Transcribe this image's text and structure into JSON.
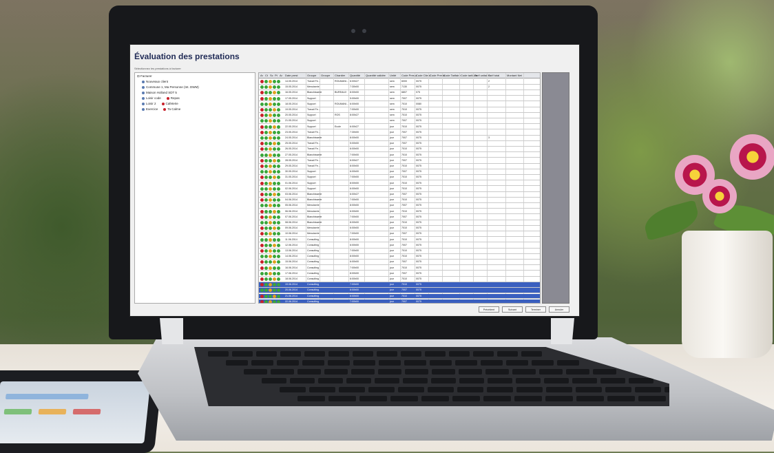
{
  "window": {
    "title": "Évaluation des prestations",
    "subtitle": "Sélectionnez les prestations à facturer"
  },
  "tree": {
    "root": "Facturer",
    "items": [
      {
        "label": "Nouveaux client",
        "badge": ""
      },
      {
        "label": "Commune 1, Ma Personne (Int. DWM)",
        "badge": ""
      },
      {
        "label": "Maison Holland SDT 5",
        "badge": ""
      },
      {
        "label": "Loisir code",
        "badge": "Repas"
      },
      {
        "label": "Loisir 2",
        "badge": "Cafeterie"
      },
      {
        "label": "Exercice",
        "badge": "Ta Calme"
      }
    ]
  },
  "grid": {
    "columns": [
      "Ar",
      "Ct",
      "Sc",
      "Pt",
      "Ar",
      "Date prest",
      "Groupe",
      "Groupe",
      "Chantier",
      "Quantité",
      "Quantité validée",
      "Unité",
      "Code Presta",
      "Code Client",
      "Code Presta",
      "Code Tarifaire",
      "Code tarifaire",
      "Tarif unitaire",
      "Tarif total",
      "Montant Net"
    ],
    "rows": [
      {
        "date": "14.05.2014",
        "group": "Travail Fe...",
        "chantier": "ROUMANI...",
        "qty": "6:00h27",
        "unit": "sem",
        "code1": "6000",
        "code2": "0075",
        "num": "2",
        "sel": false
      },
      {
        "date": "15.05.2014",
        "group": "Menuiserie",
        "chantier": "",
        "qty": "7:30h00",
        "unit": "sem",
        "code1": "7130",
        "code2": "0075",
        "num": "2",
        "sel": false
      },
      {
        "date": "16.05.2014",
        "group": "Blanchisserie",
        "chantier": "BUREAUX",
        "qty": "8:00h00",
        "unit": "sem",
        "code1": "6807",
        "code2": "075",
        "num": "",
        "sel": false
      },
      {
        "date": "17.05.2014",
        "group": "Support",
        "chantier": "",
        "qty": "5:00h00",
        "unit": "sem",
        "code1": "7007",
        "code2": "0075",
        "num": "",
        "sel": false
      },
      {
        "date": "18.05.2014",
        "group": "Support",
        "chantier": "ROUMANI...",
        "qty": "6:00h00",
        "unit": "sem",
        "code1": "7010",
        "code2": "0080",
        "num": "",
        "sel": false
      },
      {
        "date": "19.05.2014",
        "group": "Travail Fe...",
        "chantier": "",
        "qty": "7:00h00",
        "unit": "sem",
        "code1": "7010",
        "code2": "0075",
        "num": "",
        "sel": false
      },
      {
        "date": "20.05.2014",
        "group": "Support",
        "chantier": "ROS",
        "qty": "8:00h27",
        "unit": "sem",
        "code1": "7010",
        "code2": "0075",
        "num": "",
        "sel": false
      },
      {
        "date": "21.05.2014",
        "group": "Support",
        "chantier": "",
        "qty": "",
        "unit": "sem",
        "code1": "7007",
        "code2": "0075",
        "num": "",
        "sel": false
      },
      {
        "date": "22.05.2014",
        "group": "Support",
        "chantier": "Ecole",
        "qty": "6:00h27",
        "unit": "jour",
        "code1": "7010",
        "code2": "0075",
        "num": "",
        "sel": false
      },
      {
        "date": "23.05.2014",
        "group": "Travail Fe...",
        "chantier": "",
        "qty": "7:30h00",
        "unit": "jour",
        "code1": "7007",
        "code2": "0075",
        "num": "",
        "sel": false
      },
      {
        "date": "24.05.2014",
        "group": "Blanchisserie",
        "chantier": "",
        "qty": "8:00h00",
        "unit": "jour",
        "code1": "7007",
        "code2": "0075",
        "num": "3",
        "sel": false
      },
      {
        "date": "25.05.2014",
        "group": "Travail Fe...",
        "chantier": "",
        "qty": "5:00h00",
        "unit": "jour",
        "code1": "7007",
        "code2": "0075",
        "num": "",
        "sel": false
      },
      {
        "date": "26.05.2014",
        "group": "Travail Fe...",
        "chantier": "",
        "qty": "6:00h00",
        "unit": "jour",
        "code1": "7010",
        "code2": "0075",
        "num": "",
        "sel": false
      },
      {
        "date": "27.05.2014",
        "group": "Blanchisserie",
        "chantier": "",
        "qty": "7:00h00",
        "unit": "jour",
        "code1": "7010",
        "code2": "0075",
        "num": "",
        "sel": false
      },
      {
        "date": "28.05.2014",
        "group": "Travail Fe...",
        "chantier": "",
        "qty": "6:00h27",
        "unit": "jour",
        "code1": "7007",
        "code2": "0075",
        "num": "",
        "sel": false
      },
      {
        "date": "29.05.2014",
        "group": "Travail Fe...",
        "chantier": "",
        "qty": "8:00h00",
        "unit": "jour",
        "code1": "7010",
        "code2": "0075",
        "num": "",
        "sel": false
      },
      {
        "date": "30.05.2014",
        "group": "Support",
        "chantier": "",
        "qty": "6:00h00",
        "unit": "jour",
        "code1": "7007",
        "code2": "0075",
        "num": "",
        "sel": false
      },
      {
        "date": "31.05.2014",
        "group": "Support",
        "chantier": "",
        "qty": "7:00h00",
        "unit": "jour",
        "code1": "7010",
        "code2": "0075",
        "num": "",
        "sel": false
      },
      {
        "date": "01.06.2014",
        "group": "Support",
        "chantier": "",
        "qty": "8:00h00",
        "unit": "jour",
        "code1": "7010",
        "code2": "0075",
        "num": "",
        "sel": false
      },
      {
        "date": "02.06.2014",
        "group": "Support",
        "chantier": "",
        "qty": "6:00h00",
        "unit": "jour",
        "code1": "7010",
        "code2": "0075",
        "num": "",
        "sel": false
      },
      {
        "date": "03.06.2014",
        "group": "Blanchisserie",
        "chantier": "",
        "qty": "6:00h27",
        "unit": "jour",
        "code1": "7007",
        "code2": "0075",
        "num": "",
        "sel": false
      },
      {
        "date": "04.06.2014",
        "group": "Blanchisserie",
        "chantier": "",
        "qty": "7:00h00",
        "unit": "jour",
        "code1": "7010",
        "code2": "0075",
        "num": "",
        "sel": false
      },
      {
        "date": "05.06.2014",
        "group": "Menuiserie",
        "chantier": "",
        "qty": "8:00h00",
        "unit": "jour",
        "code1": "7007",
        "code2": "0075",
        "num": "",
        "sel": false
      },
      {
        "date": "06.06.2014",
        "group": "Menuiserie",
        "chantier": "",
        "qty": "6:00h00",
        "unit": "jour",
        "code1": "7010",
        "code2": "0075",
        "num": "",
        "sel": false
      },
      {
        "date": "07.06.2014",
        "group": "Blanchisserie",
        "chantier": "",
        "qty": "7:00h00",
        "unit": "jour",
        "code1": "7007",
        "code2": "0075",
        "num": "",
        "sel": false
      },
      {
        "date": "08.06.2014",
        "group": "Blanchisserie",
        "chantier": "",
        "qty": "8:00h00",
        "unit": "jour",
        "code1": "7010",
        "code2": "0075",
        "num": "",
        "sel": false
      },
      {
        "date": "09.06.2014",
        "group": "Menuiserie",
        "chantier": "",
        "qty": "6:00h00",
        "unit": "jour",
        "code1": "7010",
        "code2": "0075",
        "num": "",
        "sel": false
      },
      {
        "date": "10.06.2014",
        "group": "Menuiserie",
        "chantier": "",
        "qty": "7:00h00",
        "unit": "jour",
        "code1": "7007",
        "code2": "0075",
        "num": "",
        "sel": false
      },
      {
        "date": "11.06.2014",
        "group": "Consulting",
        "chantier": "",
        "qty": "8:00h00",
        "unit": "jour",
        "code1": "7010",
        "code2": "0075",
        "num": "",
        "sel": false
      },
      {
        "date": "12.06.2014",
        "group": "Consulting",
        "chantier": "",
        "qty": "6:00h00",
        "unit": "jour",
        "code1": "7007",
        "code2": "0075",
        "num": "",
        "sel": false
      },
      {
        "date": "13.06.2014",
        "group": "Consulting",
        "chantier": "",
        "qty": "7:00h00",
        "unit": "jour",
        "code1": "7010",
        "code2": "0075",
        "num": "",
        "sel": false
      },
      {
        "date": "14.06.2014",
        "group": "Consulting",
        "chantier": "",
        "qty": "8:00h00",
        "unit": "jour",
        "code1": "7010",
        "code2": "0075",
        "num": "",
        "sel": false
      },
      {
        "date": "15.06.2014",
        "group": "Consulting",
        "chantier": "",
        "qty": "6:00h00",
        "unit": "jour",
        "code1": "7007",
        "code2": "0075",
        "num": "",
        "sel": false
      },
      {
        "date": "16.06.2014",
        "group": "Consulting",
        "chantier": "",
        "qty": "7:00h00",
        "unit": "jour",
        "code1": "7010",
        "code2": "0075",
        "num": "",
        "sel": false
      },
      {
        "date": "17.06.2014",
        "group": "Consulting",
        "chantier": "",
        "qty": "8:00h00",
        "unit": "jour",
        "code1": "7007",
        "code2": "0075",
        "num": "",
        "sel": false
      },
      {
        "date": "18.06.2014",
        "group": "Consulting",
        "chantier": "",
        "qty": "6:00h00",
        "unit": "jour",
        "code1": "7010",
        "code2": "0075",
        "num": "",
        "sel": false
      },
      {
        "date": "19.06.2014",
        "group": "Consulting",
        "chantier": "",
        "qty": "7:00h00",
        "unit": "jour",
        "code1": "7010",
        "code2": "0075",
        "num": "",
        "sel": true
      },
      {
        "date": "20.06.2014",
        "group": "Consulting",
        "chantier": "",
        "qty": "8:00h00",
        "unit": "jour",
        "code1": "7007",
        "code2": "0075",
        "num": "",
        "sel": true
      },
      {
        "date": "21.06.2014",
        "group": "Consulting",
        "chantier": "",
        "qty": "6:00h00",
        "unit": "jour",
        "code1": "7010",
        "code2": "0075",
        "num": "",
        "sel": true
      },
      {
        "date": "22.06.2014",
        "group": "Consulting",
        "chantier": "",
        "qty": "7:00h00",
        "unit": "jour",
        "code1": "7007",
        "code2": "0075",
        "num": "",
        "sel": true
      }
    ]
  },
  "buttons": {
    "prev": "Précédent",
    "next": "Suivant",
    "finish": "Terminer",
    "cancel": "Annuler"
  },
  "colors": {
    "selection": "#3a5fbf",
    "title": "#1f2a55",
    "status_ok": "#3aa53a",
    "status_warn": "#e0a020",
    "status_err": "#c8202a"
  }
}
